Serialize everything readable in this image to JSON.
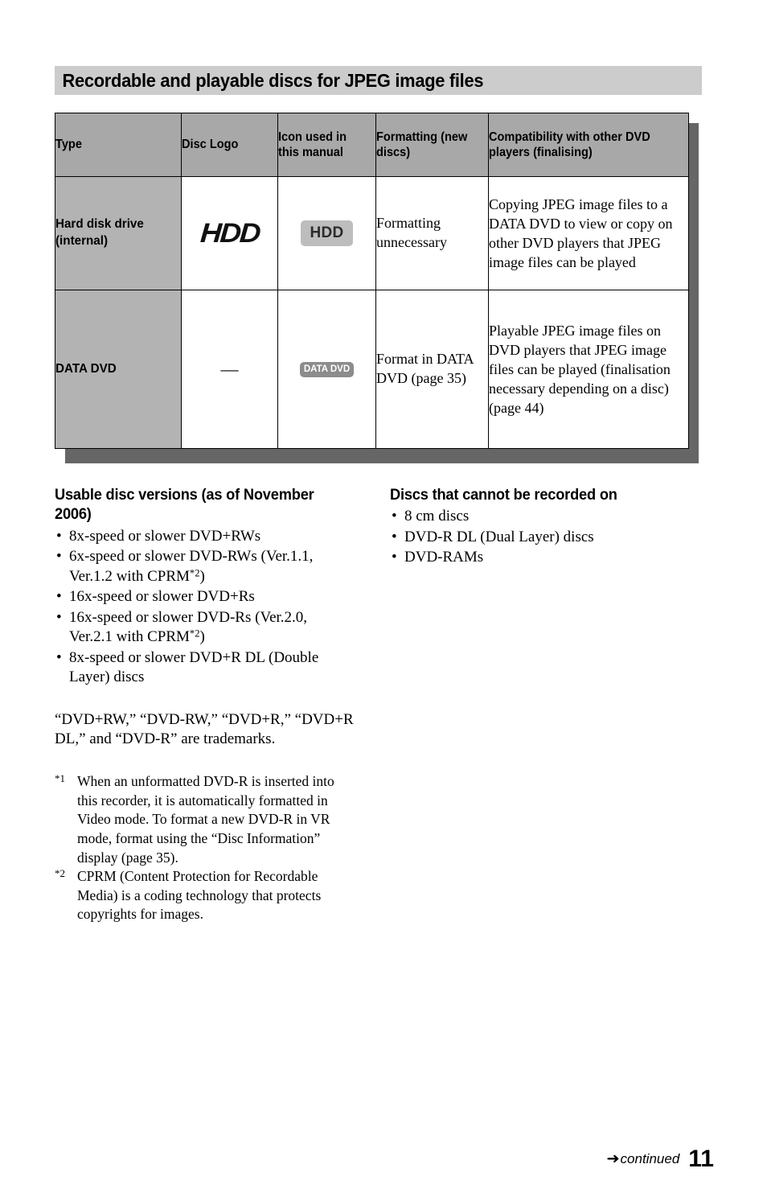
{
  "page": {
    "title": "Recordable and playable discs for JPEG image files",
    "number": "11",
    "continued_label": "continued",
    "continued_icon": "right-arrow-icon",
    "colors": {
      "title_band": "#cccccc",
      "table_header": "#a8a8a8",
      "table_type_cell": "#b3b3b3",
      "table_shadow": "#666666",
      "badge_hdd": "#bdbdbd",
      "badge_datadvd": "#8c8c8c"
    }
  },
  "table": {
    "headers": [
      "Type",
      "Disc Logo",
      "Icon used in this manual",
      "Formatting (new discs)",
      "Compatibility with other DVD players (finalising)"
    ],
    "rows": [
      {
        "type": "Hard disk drive (internal)",
        "disc_logo": "HDD",
        "disc_logo_kind": "hdd-wordmark",
        "icon_label": "HDD",
        "icon_kind": "hdd-badge",
        "formatting": "Formatting unnecessary",
        "compatibility": "Copying JPEG image files to a DATA DVD to view or copy on other DVD players that JPEG image files can be played"
      },
      {
        "type": "DATA DVD",
        "disc_logo": "—",
        "disc_logo_kind": "em-dash",
        "icon_label": "DATA DVD",
        "icon_kind": "data-dvd-badge",
        "formatting": "Format in DATA DVD (page 35)",
        "compatibility": "Playable JPEG image files on DVD players that JPEG image files can be played (finalisation necessary depending on a disc) (page 44)"
      }
    ]
  },
  "usable_versions": {
    "heading": "Usable disc versions (as of November 2006)",
    "items": [
      {
        "pre": "8x-speed or slower DVD+RWs",
        "sup": "",
        "post": ""
      },
      {
        "pre": "6x-speed or slower DVD-RWs (Ver.1.1, Ver.1.2 with CPRM",
        "sup": "*2",
        "post": ")"
      },
      {
        "pre": "16x-speed or slower DVD+Rs",
        "sup": "",
        "post": ""
      },
      {
        "pre": "16x-speed or slower DVD-Rs (Ver.2.0, Ver.2.1 with CPRM",
        "sup": "*2",
        "post": ")"
      },
      {
        "pre": "8x-speed or slower DVD+R DL (Double Layer) discs",
        "sup": "",
        "post": ""
      }
    ]
  },
  "cannot_record": {
    "heading": "Discs that cannot be recorded on",
    "items": [
      {
        "pre": "8 cm discs",
        "sup": "",
        "post": ""
      },
      {
        "pre": "DVD-R DL (Dual Layer) discs",
        "sup": "",
        "post": ""
      },
      {
        "pre": "DVD-RAMs",
        "sup": "",
        "post": ""
      }
    ]
  },
  "trademarks": "“DVD+RW,” “DVD-RW,” “DVD+R,” “DVD+R DL,” and “DVD-R” are trademarks.",
  "footnotes": [
    {
      "mark": "*1",
      "text": "When an unformatted DVD-R is inserted into this recorder, it is automatically formatted in Video mode. To format a new DVD-R in VR mode, format using the “Disc Information” display (page 35)."
    },
    {
      "mark": "*2",
      "text": "CPRM (Content Protection for Recordable Media) is a coding technology that protects copyrights for images."
    }
  ]
}
